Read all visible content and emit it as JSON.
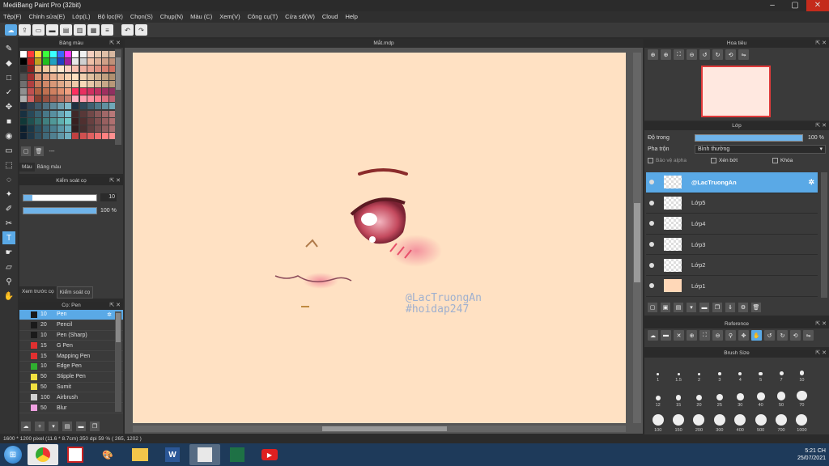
{
  "window": {
    "title": "MediBang Paint Pro (32bit)"
  },
  "menu": [
    "Tệp(F)",
    "Chỉnh sửa(E)",
    "Lớp(L)",
    "Bộ lọc(R)",
    "Chọn(S)",
    "Chụp(N)",
    "Màu (C)",
    "Xem(V)",
    "Công cụ(T)",
    "Cửa sổ(W)",
    "Cloud",
    "Help"
  ],
  "palette": {
    "title": "Bảng màu",
    "count_label": "---",
    "tabs": [
      "Màu",
      "Bảng màu"
    ],
    "colors": [
      "#ffffff",
      "#ff3b3b",
      "#ffd23b",
      "#3bff3b",
      "#3bffff",
      "#3b6bff",
      "#ff3bff",
      "#ffffff",
      "#f0f0f0",
      "#f5d0c0",
      "#e8c8b0",
      "#e0c0a8",
      "#d8b8a0",
      "#000000",
      "#c02020",
      "#c0a020",
      "#20c020",
      "#20a0c0",
      "#2040c0",
      "#a020a0",
      "#e8e8e8",
      "#d0d0d0",
      "#f0c0a8",
      "#e0b098",
      "#d0a088",
      "#c09078",
      "#303030",
      "#8a2020",
      "#e8b080",
      "#f0c8a0",
      "#f8d8b8",
      "#ffe8d0",
      "#ffd0c0",
      "#f8c0b0",
      "#f0b0a0",
      "#e8a090",
      "#e09080",
      "#d88070",
      "#d07060",
      "#505050",
      "#a03030",
      "#d89070",
      "#e0a080",
      "#e8b090",
      "#f0c0a0",
      "#f8d0b0",
      "#ffe0c0",
      "#f0d0b0",
      "#e0c0a0",
      "#d0b090",
      "#c0a080",
      "#b09070",
      "#707070",
      "#b04040",
      "#c87858",
      "#d08868",
      "#d89878",
      "#e0a888",
      "#e8b898",
      "#f0c8a8",
      "#f8d8b8",
      "#e8c8a8",
      "#d8b898",
      "#c8a888",
      "#b89878",
      "#909090",
      "#c05050",
      "#b06040",
      "#c07050",
      "#d08060",
      "#e09070",
      "#f0a080",
      "#ff3060",
      "#e83060",
      "#d03060",
      "#c03060",
      "#a03060",
      "#903060",
      "#b0b0b0",
      "#d06060",
      "#884030",
      "#985040",
      "#a86050",
      "#b87060",
      "#c88070",
      "#ffb0c0",
      "#ffa0b0",
      "#ff90a0",
      "#ff8090",
      "#e07080",
      "#c06070",
      "#202838",
      "#304050",
      "#405868",
      "#507080",
      "#608898",
      "#70a0b0",
      "#80b8c8",
      "#203040",
      "#304858",
      "#406070",
      "#507888",
      "#6090a0",
      "#70a8b8",
      "#183040",
      "#284858",
      "#386070",
      "#487888",
      "#5890a0",
      "#68a8b8",
      "#78c0d0",
      "#402828",
      "#583838",
      "#704848",
      "#885858",
      "#a06868",
      "#b87878",
      "#103838",
      "#205050",
      "#306868",
      "#408080",
      "#509898",
      "#60b0b0",
      "#70c8c8",
      "#382020",
      "#503030",
      "#684040",
      "#805050",
      "#986060",
      "#b07070",
      "#0a2030",
      "#1a3848",
      "#2a5060",
      "#3a6878",
      "#4a8090",
      "#5a98a8",
      "#6ab0c0",
      "#302020",
      "#483030",
      "#604040",
      "#785050",
      "#906060",
      "#a87070",
      "#102030",
      "#203848",
      "#305060",
      "#406878",
      "#508090",
      "#6098a8",
      "#70b0c0",
      "#c04040",
      "#d05050",
      "#e06060",
      "#f07070",
      "#ff8080",
      "#ff9090"
    ]
  },
  "brush_control": {
    "title": "Kiểm soát cọ",
    "size_value": "10",
    "opacity_value": "100 %",
    "size_frac": 0.12,
    "opacity_frac": 1.0,
    "tabs": [
      "Xem trước cọ",
      "Kiểm soát cọ"
    ]
  },
  "brushes": {
    "title": "Cọ: Pen",
    "items": [
      {
        "size": "10",
        "name": "Pen",
        "color": "#1a1a1a",
        "selected": true
      },
      {
        "size": "20",
        "name": "Pencil",
        "color": "#1a1a1a"
      },
      {
        "size": "10",
        "name": "Pen (Sharp)",
        "color": "#1a1a1a"
      },
      {
        "size": "15",
        "name": "G Pen",
        "color": "#e03030"
      },
      {
        "size": "15",
        "name": "Mapping Pen",
        "color": "#e03030"
      },
      {
        "size": "10",
        "name": "Edge Pen",
        "color": "#30b030"
      },
      {
        "size": "50",
        "name": "Stipple Pen",
        "color": "#f0e040"
      },
      {
        "size": "50",
        "name": "Sumit",
        "color": "#f0e040"
      },
      {
        "size": "100",
        "name": "Airbrush",
        "color": "#d0d0d0"
      },
      {
        "size": "50",
        "name": "Blur",
        "color": "#f0a0e0"
      }
    ]
  },
  "document": {
    "tab": "Mắt.mdp"
  },
  "canvas": {
    "watermark_line1": "@LacTruongAn",
    "watermark_line2": "#hoidap247",
    "bg_color": "#ffe1c3"
  },
  "navigator": {
    "title": "Hoa tiêu"
  },
  "layers": {
    "title": "Lớp",
    "opacity_label": "Độ trong",
    "opacity_value": "100 %",
    "blend_label": "Pha trộn",
    "blend_value": "Bình thường",
    "protect_alpha": "Bảo vệ alpha",
    "clipping": "Xén bớt",
    "lock": "Khóa",
    "items": [
      {
        "name": "@LacTruongAn",
        "selected": true
      },
      {
        "name": "Lớp5"
      },
      {
        "name": "Lớp4"
      },
      {
        "name": "Lớp3"
      },
      {
        "name": "Lớp2"
      },
      {
        "name": "Lớp1",
        "fill": "#ffd8b8"
      }
    ]
  },
  "reference": {
    "title": "Reference"
  },
  "brush_size": {
    "title": "Brush Size",
    "sizes": [
      "1",
      "1.5",
      "2",
      "3",
      "4",
      "5",
      "7",
      "10",
      "12",
      "15",
      "20",
      "25",
      "30",
      "40",
      "50",
      "70",
      "100",
      "150",
      "200",
      "300",
      "400",
      "500",
      "700",
      "1000"
    ]
  },
  "status": {
    "text": "1600 * 1200 pixel   (11.6 * 8.7cm)   350 dpi   59 %   ( 265, 1202 )"
  },
  "taskbar": {
    "time": "5:21 CH",
    "date": "25/07/2021",
    "apps": [
      "chrome",
      "ms-paint",
      "paint",
      "explorer",
      "word",
      "medibang",
      "excel",
      "youtube"
    ]
  }
}
